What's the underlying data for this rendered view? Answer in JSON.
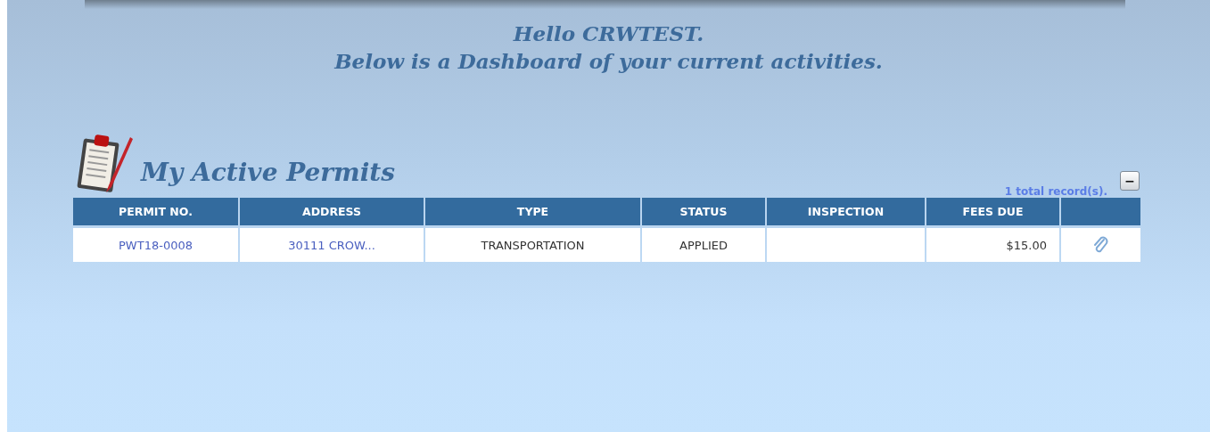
{
  "greeting": [
    "Hello CRWTEST.",
    "Below is a Dashboard of your current activities."
  ],
  "permits": {
    "title": "My Active Permits",
    "record_count": "1 total record(s).",
    "collapse_button": "−",
    "table": {
      "columns": [
        "PERMIT NO.",
        "ADDRESS",
        "TYPE",
        "STATUS",
        "INSPECTION",
        "FEES DUE"
      ],
      "rows": [
        {
          "permit_no": "PWT18-0008",
          "address": "30111 CROW...",
          "type": "TRANSPORTATION",
          "status": "APPLIED",
          "fees_due": "$15.00",
          "has_attachment": true
        }
      ]
    }
  }
}
